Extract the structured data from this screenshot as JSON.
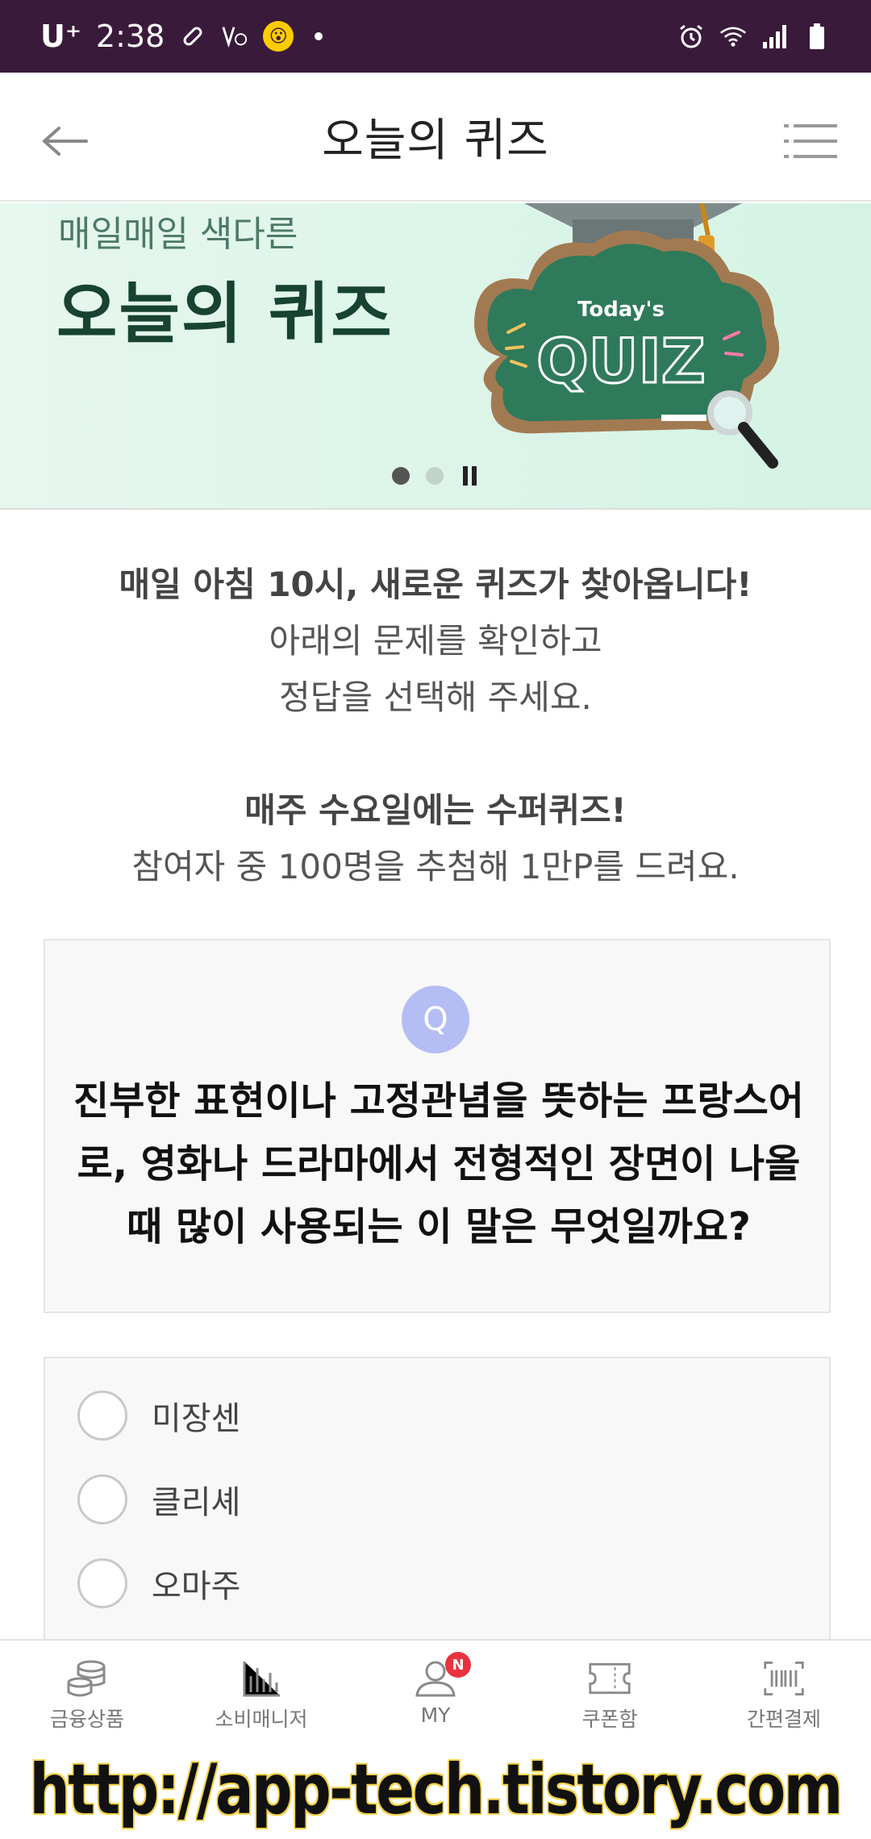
{
  "status_bar": {
    "carrier": "U⁺",
    "time": "2:38",
    "badge": "😮",
    "icons": [
      "pill-icon",
      "volte-icon",
      "notification-badge-icon",
      "alarm-icon",
      "wifi-icon",
      "signal-icon",
      "battery-icon"
    ]
  },
  "header": {
    "title": "오늘의 퀴즈",
    "back_icon": "back-arrow-icon",
    "menu_icon": "hamburger-menu-icon"
  },
  "banner": {
    "subtitle": "매일매일 색다른",
    "title": "오늘의 퀴즈",
    "art_caption_small": "Today's",
    "art_caption_large": "QUIZ",
    "slides": 2,
    "active_slide": 1
  },
  "intro": {
    "line1": "매일 아침 10시, 새로운 퀴즈가 찾아옵니다!",
    "line2": "아래의 문제를 확인하고",
    "line3": "정답을 선택해 주세요.",
    "line4": "매주 수요일에는 수퍼퀴즈!",
    "line5": "참여자 중 100명을 추첨해 1만P를 드려요."
  },
  "question": {
    "badge": "Q",
    "line1": "진부한 표현이나 고정관념을 뜻하는 프랑스어",
    "line2": "로, 영화나 드라마에서 전형적인 장면이 나올",
    "line3": "때 많이 사용되는 이 말은 무엇일까요?"
  },
  "options": [
    {
      "label": "미장센"
    },
    {
      "label": "클리셰"
    },
    {
      "label": "오마주"
    }
  ],
  "bottom_nav": {
    "items": [
      {
        "label": "금융상품",
        "icon": "coins-icon"
      },
      {
        "label": "소비매니저",
        "icon": "bar-chart-icon"
      },
      {
        "label": "MY",
        "icon": "person-icon",
        "badge": "N"
      },
      {
        "label": "쿠폰함",
        "icon": "ticket-icon"
      },
      {
        "label": "간편결제",
        "icon": "barcode-icon"
      }
    ]
  },
  "watermark": "http://app-tech.tistory.com",
  "colors": {
    "status_bar": "#3a1a3a",
    "banner_bg": "#d4f3e4",
    "banner_title": "#17432f",
    "q_badge": "#b5bdf5",
    "nav_badge": "#e8333f"
  }
}
